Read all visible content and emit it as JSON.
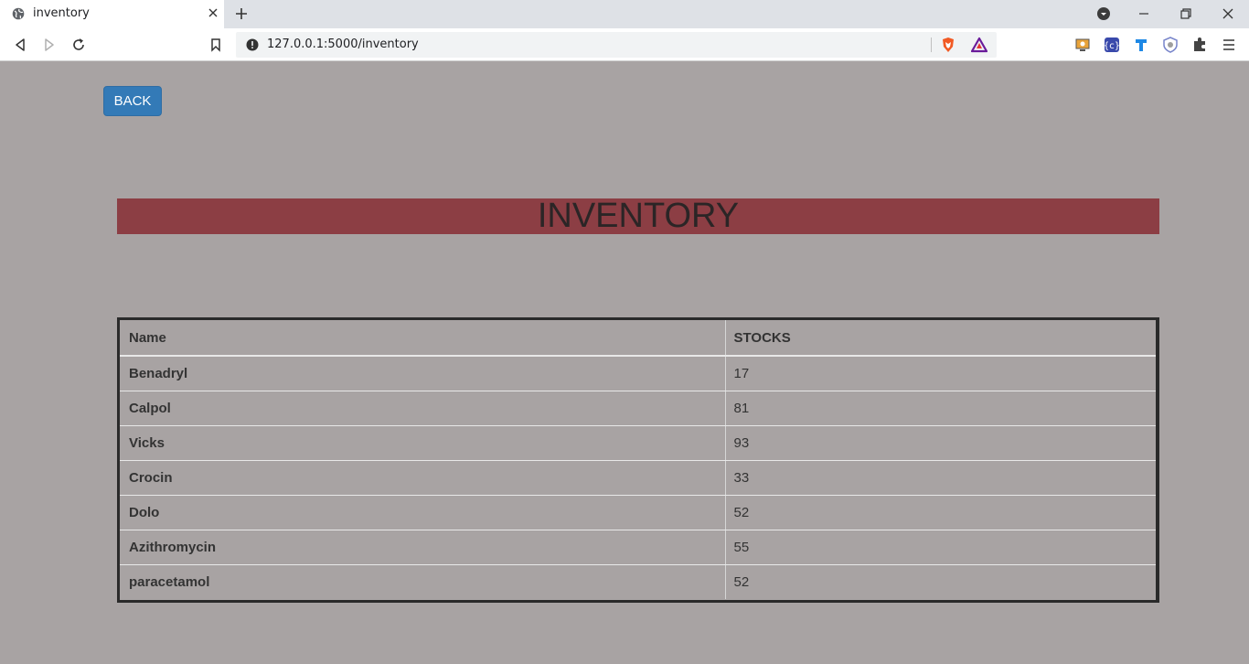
{
  "browser": {
    "tab_title": "inventory",
    "url": "127.0.0.1:5000/inventory"
  },
  "page": {
    "back_label": "BACK",
    "heading": "INVENTORY",
    "table": {
      "headers": [
        "Name",
        "STOCKS"
      ],
      "rows": [
        {
          "name": "Benadryl",
          "stock": "17"
        },
        {
          "name": "Calpol",
          "stock": "81"
        },
        {
          "name": "Vicks",
          "stock": "93"
        },
        {
          "name": "Crocin",
          "stock": "33"
        },
        {
          "name": "Dolo",
          "stock": "52"
        },
        {
          "name": "Azithromycin",
          "stock": "55"
        },
        {
          "name": "paracetamol",
          "stock": "52"
        }
      ]
    }
  },
  "colors": {
    "page_bg": "#a8a3a3",
    "heading_bg": "#8c3e44",
    "button_bg": "#337ab7"
  }
}
